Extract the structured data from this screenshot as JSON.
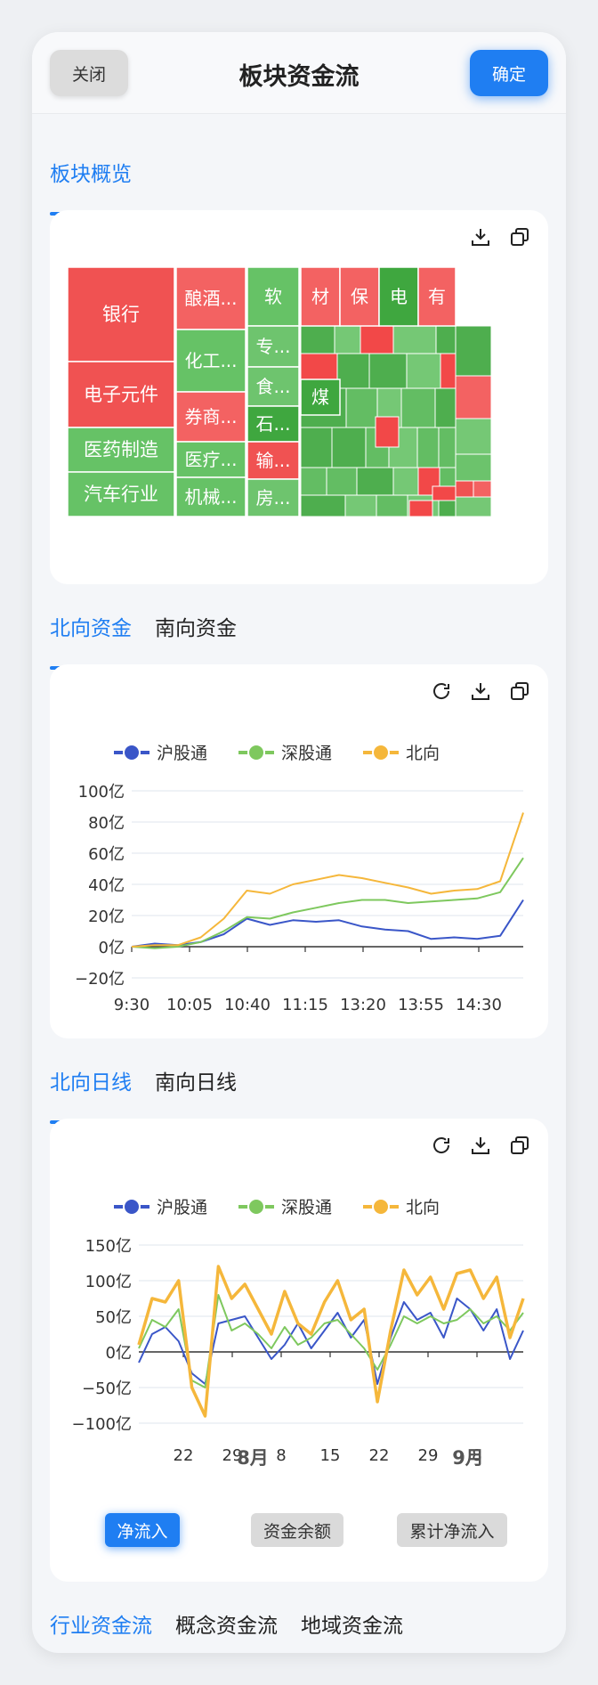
{
  "header": {
    "title": "板块资金流",
    "close_label": "关闭",
    "ok_label": "确定"
  },
  "section1": {
    "tabs": [
      "板块概览"
    ]
  },
  "treemap": {
    "cells_labeled": [
      {
        "label": "银行",
        "color": "#f05252"
      },
      {
        "label": "电子元件",
        "color": "#f05252"
      },
      {
        "label": "医药制造",
        "color": "#66c266"
      },
      {
        "label": "汽车行业",
        "color": "#66c266"
      },
      {
        "label": "酿酒...",
        "color": "#f36262"
      },
      {
        "label": "化工...",
        "color": "#66c266"
      },
      {
        "label": "券商...",
        "color": "#f36262"
      },
      {
        "label": "医疗...",
        "color": "#66c266"
      },
      {
        "label": "机械...",
        "color": "#66c266"
      },
      {
        "label": "软",
        "color": "#66c266"
      },
      {
        "label": "专...",
        "color": "#6ec46e"
      },
      {
        "label": "食...",
        "color": "#6ec46e"
      },
      {
        "label": "石...",
        "color": "#3fa73f"
      },
      {
        "label": "输...",
        "color": "#f05252"
      },
      {
        "label": "房...",
        "color": "#6ec46e"
      },
      {
        "label": "材",
        "color": "#f36262"
      },
      {
        "label": "保",
        "color": "#f36262"
      },
      {
        "label": "电",
        "color": "#3fa73f"
      },
      {
        "label": "有",
        "color": "#f36262"
      },
      {
        "label": "煤",
        "color": "#3fa73f"
      }
    ]
  },
  "section2": {
    "tabs": [
      "北向资金",
      "南向资金"
    ]
  },
  "chart1": {
    "legend": [
      "沪股通",
      "深股通",
      "北向"
    ],
    "yticks": [
      "100亿",
      "80亿",
      "60亿",
      "40亿",
      "20亿",
      "0亿",
      "−20亿"
    ],
    "xticks": [
      "9:30",
      "10:05",
      "10:40",
      "11:15",
      "13:20",
      "13:55",
      "14:30"
    ]
  },
  "section3": {
    "tabs": [
      "北向日线",
      "南向日线"
    ]
  },
  "chart2": {
    "legend": [
      "沪股通",
      "深股通",
      "北向"
    ],
    "yticks": [
      "150亿",
      "100亿",
      "50亿",
      "0亿",
      "−50亿",
      "−100亿"
    ],
    "xticks": [
      "22",
      "29",
      "8",
      "15",
      "22",
      "29",
      "8"
    ],
    "month_labels": [
      "8月",
      "9月"
    ]
  },
  "bottom_buttons": {
    "net_inflow": "净流入",
    "balance": "资金余额",
    "cumulative": "累计净流入"
  },
  "section4": {
    "tabs": [
      "行业资金流",
      "概念资金流",
      "地域资金流"
    ]
  },
  "colors": {
    "accent": "#1f7ef2",
    "sh": "#3a56c8",
    "sz": "#7ec85e",
    "north": "#f5b73b",
    "red": "#f05252",
    "green": "#66c266"
  },
  "chart_data": [
    {
      "type": "line",
      "x_range": [
        "9:30",
        "15:00"
      ],
      "ylim": [
        -20,
        100
      ],
      "series": [
        {
          "name": "沪股通",
          "values": [
            0,
            2,
            1,
            3,
            8,
            18,
            14,
            17,
            16,
            17,
            13,
            11,
            10,
            5,
            6,
            5,
            7,
            30
          ]
        },
        {
          "name": "深股通",
          "values": [
            0,
            -1,
            0,
            3,
            10,
            19,
            18,
            22,
            25,
            28,
            30,
            30,
            28,
            29,
            30,
            31,
            35,
            57
          ]
        },
        {
          "name": "北向",
          "values": [
            0,
            1,
            1,
            6,
            18,
            36,
            34,
            40,
            43,
            46,
            44,
            41,
            38,
            34,
            36,
            37,
            42,
            86
          ]
        }
      ]
    },
    {
      "type": "line",
      "ylim": [
        -100,
        150
      ],
      "series": [
        {
          "name": "沪股通",
          "values": [
            -15,
            25,
            35,
            15,
            -30,
            -45,
            40,
            45,
            50,
            20,
            -10,
            10,
            40,
            5,
            30,
            55,
            20,
            45,
            -45,
            20,
            70,
            45,
            55,
            20,
            75,
            60,
            30,
            60,
            -10,
            30
          ]
        },
        {
          "name": "深股通",
          "values": [
            5,
            45,
            35,
            60,
            -40,
            -50,
            80,
            30,
            40,
            25,
            5,
            35,
            10,
            20,
            40,
            45,
            25,
            5,
            -25,
            10,
            50,
            40,
            50,
            40,
            45,
            60,
            40,
            50,
            30,
            55
          ]
        },
        {
          "name": "北向",
          "values": [
            10,
            75,
            70,
            100,
            -50,
            -90,
            120,
            75,
            95,
            60,
            25,
            85,
            40,
            25,
            70,
            100,
            45,
            60,
            -70,
            30,
            115,
            80,
            105,
            60,
            110,
            115,
            75,
            105,
            20,
            75
          ]
        }
      ]
    }
  ]
}
